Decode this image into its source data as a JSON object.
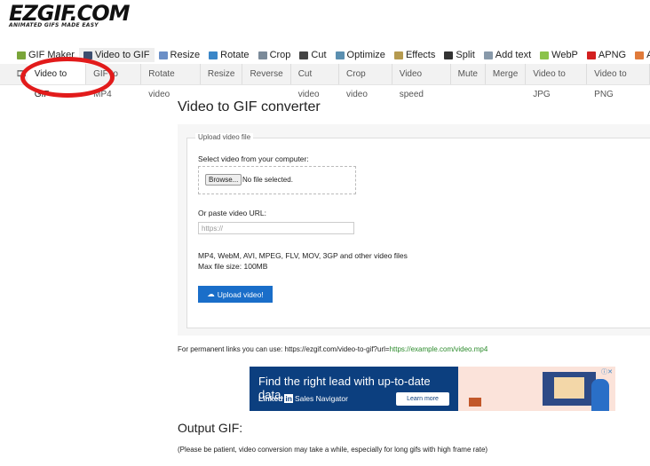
{
  "logo": {
    "name": "EZGIF.COM",
    "tagline": "ANIMATED GIFS MADE EASY"
  },
  "topnav": [
    {
      "label": "GIF Maker",
      "icon": "gif-maker-icon",
      "color": "#7aa53a"
    },
    {
      "label": "Video to GIF",
      "icon": "film-icon",
      "color": "#3c4d6e",
      "active": true
    },
    {
      "label": "Resize",
      "icon": "resize-icon",
      "color": "#6b8fc7"
    },
    {
      "label": "Rotate",
      "icon": "rotate-icon",
      "color": "#3a86c8"
    },
    {
      "label": "Crop",
      "icon": "crop-icon",
      "color": "#7b8a99"
    },
    {
      "label": "Cut",
      "icon": "cut-icon",
      "color": "#444"
    },
    {
      "label": "Optimize",
      "icon": "optimize-icon",
      "color": "#5b8fb0"
    },
    {
      "label": "Effects",
      "icon": "effects-icon",
      "color": "#b59a4f"
    },
    {
      "label": "Split",
      "icon": "split-icon",
      "color": "#333"
    },
    {
      "label": "Add text",
      "icon": "add-text-icon",
      "color": "#8899aa"
    },
    {
      "label": "WebP",
      "icon": "webp-icon",
      "color": "#8bc34a"
    },
    {
      "label": "APNG",
      "icon": "apng-icon",
      "color": "#d32020"
    },
    {
      "label": "AVIF",
      "icon": "avif-icon",
      "color": "#e07a3a"
    }
  ],
  "subnav": [
    "Video to GIF",
    "GIF to MP4",
    "Rotate video",
    "Resize",
    "Reverse",
    "Cut video",
    "Crop video",
    "Video speed",
    "Mute",
    "Merge",
    "Video to JPG",
    "Video to PNG"
  ],
  "main": {
    "title": "Video to GIF converter",
    "legend": "Upload video file",
    "select_label": "Select video from your computer:",
    "browse": "Browse...",
    "no_file": "No file selected.",
    "url_label": "Or paste video URL:",
    "url_placeholder": "https://",
    "formats": "MP4, WebM, AVI, MPEG, FLV, MOV, 3GP and other video files",
    "max_size": "Max file size: 100MB",
    "upload": "Upload video!",
    "perm_prefix": "For permanent links you can use: https://ezgif.com/video-to-gif?url=",
    "perm_example": "https://example.com/video.mp4"
  },
  "ad": {
    "headline": "Find the right lead with up-to-date data.",
    "brand": "Linked",
    "brand_in": "in",
    "product": "Sales Navigator",
    "cta": "Learn more"
  },
  "output": {
    "title": "Output GIF:",
    "note": "(Please be patient, video conversion may take a while, especially for long gifs with high frame rate)"
  },
  "accent": "#1a6ec9",
  "highlight": "#e21b1b"
}
